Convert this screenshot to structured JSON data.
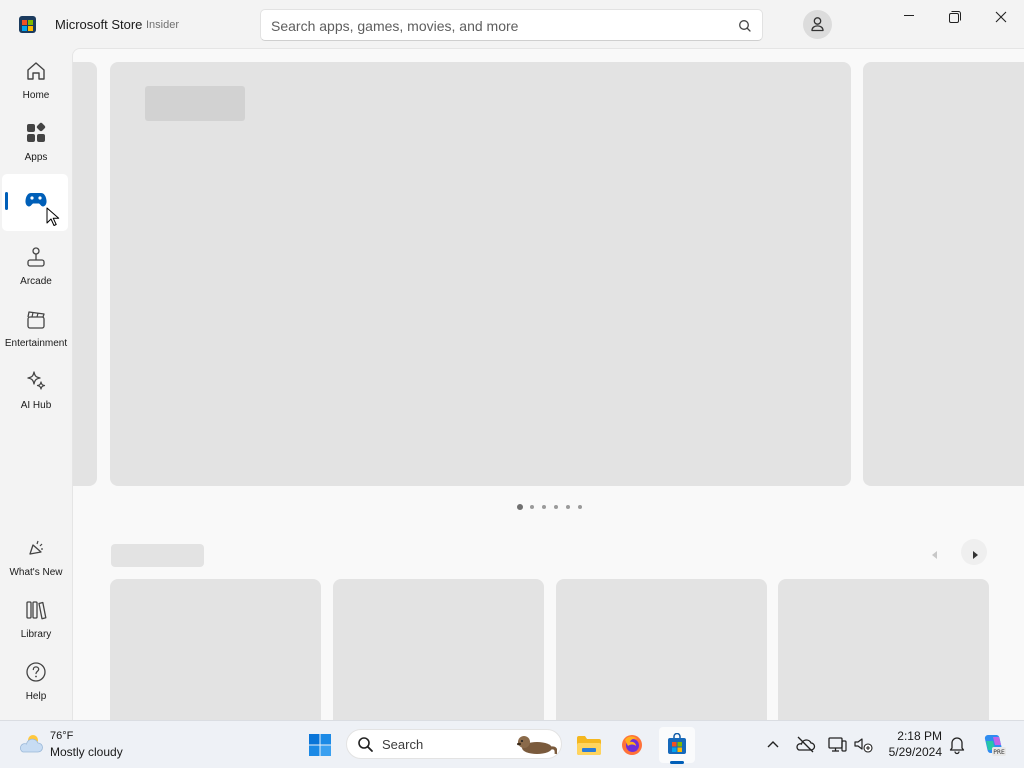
{
  "app": {
    "title": "Microsoft Store",
    "badge": "Insider"
  },
  "search": {
    "placeholder": "Search apps, games, movies, and more"
  },
  "nav": {
    "items": [
      {
        "label": "Home",
        "icon": "home-icon"
      },
      {
        "label": "Apps",
        "icon": "apps-icon"
      },
      {
        "label": "",
        "icon": "gamepad-icon",
        "active": true
      },
      {
        "label": "Arcade",
        "icon": "joystick-icon"
      },
      {
        "label": "Entertainment",
        "icon": "clapperboard-icon"
      },
      {
        "label": "AI Hub",
        "icon": "sparkle-icon"
      }
    ],
    "bottom": [
      {
        "label": "What's New",
        "icon": "megaphone-icon"
      },
      {
        "label": "Library",
        "icon": "library-icon"
      },
      {
        "label": "Help",
        "icon": "help-icon"
      }
    ]
  },
  "carousel": {
    "pages": 6,
    "active_page": 1
  },
  "taskbar": {
    "weather": {
      "temp": "76°F",
      "desc": "Mostly cloudy"
    },
    "search_label": "Search",
    "clock": {
      "time": "2:18 PM",
      "date": "5/29/2024"
    }
  },
  "colors": {
    "accent": "#005fb8",
    "placeholder": "#e3e3e3",
    "background": "#f3f3f3"
  }
}
